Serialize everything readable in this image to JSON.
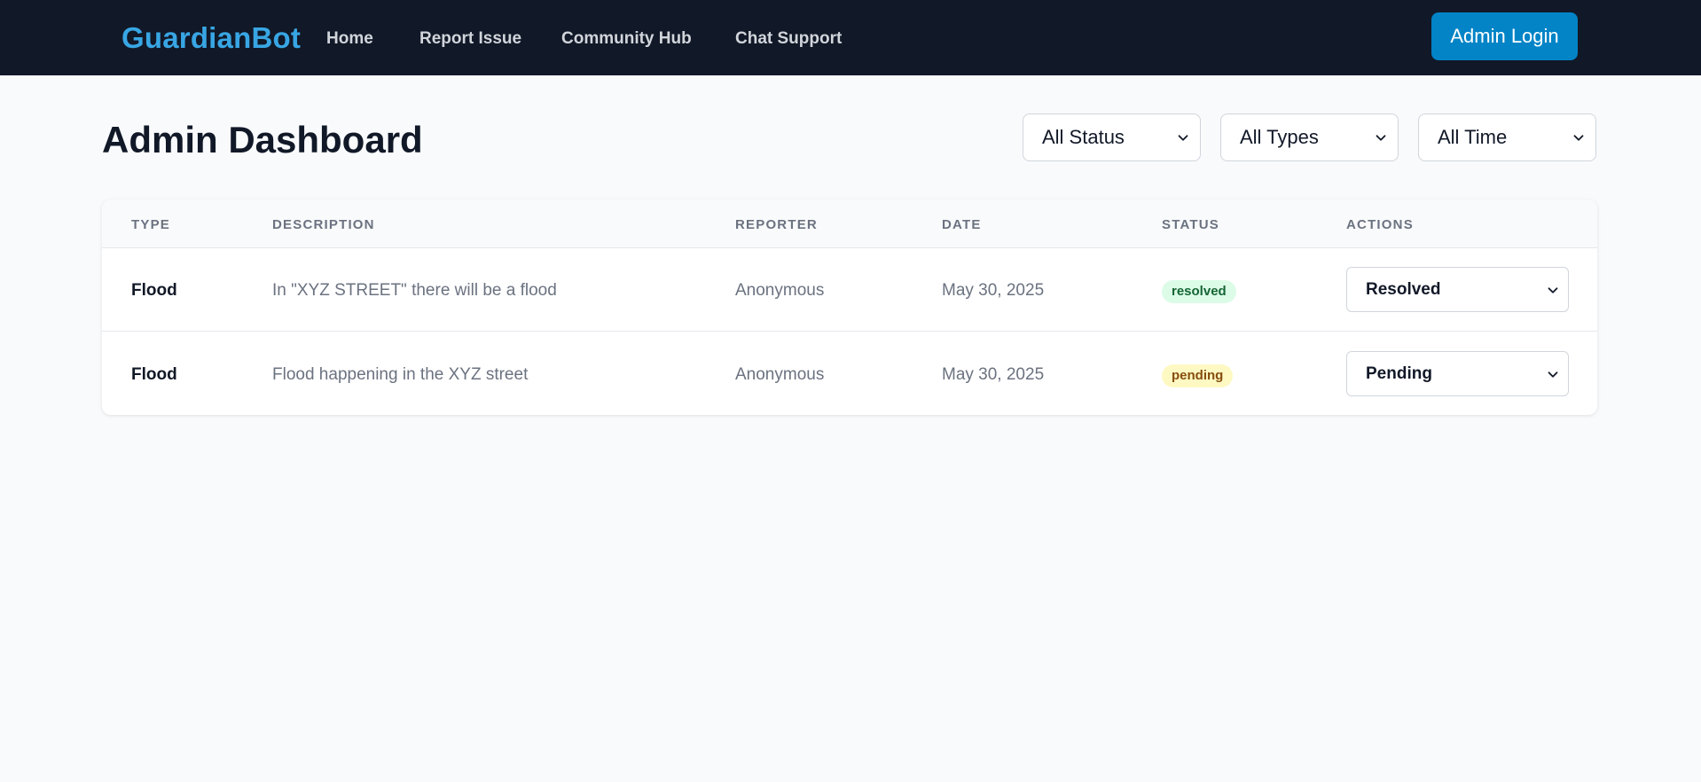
{
  "navbar": {
    "brand": "GuardianBot",
    "links": [
      "Home",
      "Report Issue",
      "Community Hub",
      "Chat Support"
    ],
    "login_label": "Admin Login",
    "background": "#111827",
    "brand_color": "#38a6e4",
    "accent": "#0284c7"
  },
  "page": {
    "title": "Admin Dashboard"
  },
  "filters": {
    "status": "All Status",
    "type": "All Types",
    "time": "All Time"
  },
  "table": {
    "headers": [
      "TYPE",
      "DESCRIPTION",
      "REPORTER",
      "DATE",
      "STATUS",
      "ACTIONS"
    ],
    "rows": [
      {
        "type": "Flood",
        "description": "In \"XYZ STREET\" there will be a flood",
        "reporter": "Anonymous",
        "date": "May 30, 2025",
        "status": "resolved",
        "action": "Resolved"
      },
      {
        "type": "Flood",
        "description": "Flood happening in the XYZ street",
        "reporter": "Anonymous",
        "date": "May 30, 2025",
        "status": "pending",
        "action": "Pending"
      }
    ]
  },
  "icons": {
    "dropdown": "chevron-down-icon"
  },
  "colors": {
    "resolved_bg": "#dcfce7",
    "resolved_text": "#166534",
    "pending_bg": "#fef9c3",
    "pending_text": "#854d0e"
  }
}
